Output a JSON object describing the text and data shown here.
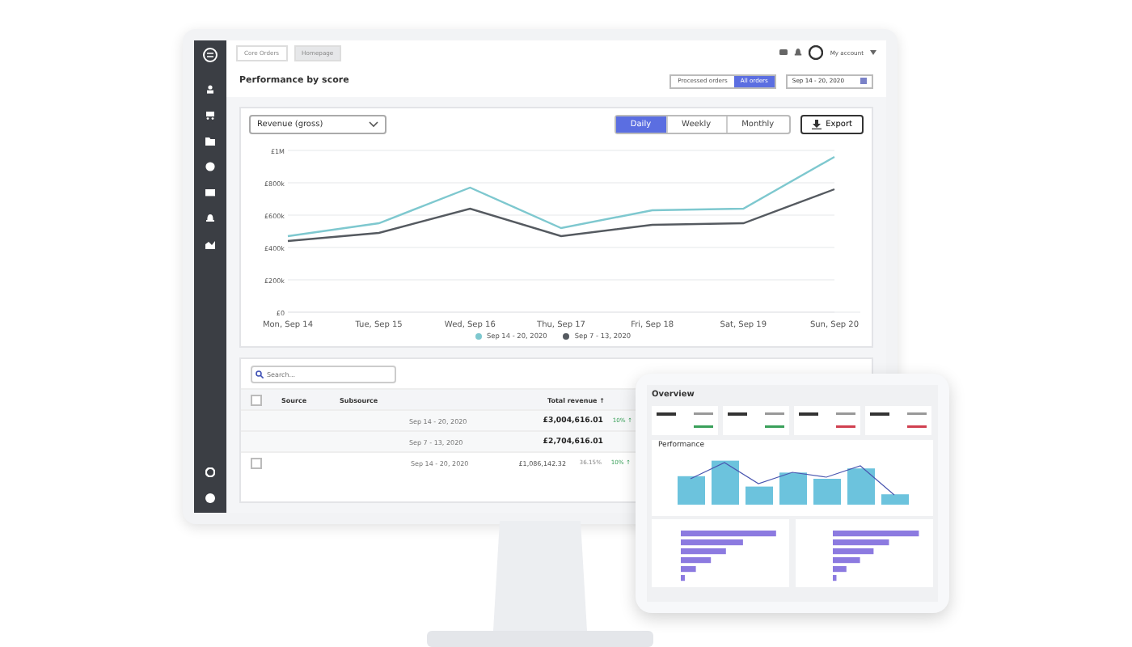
{
  "monitor": {
    "tabs": [
      {
        "label": "Core Orders",
        "selected": false
      },
      {
        "label": "Homepage",
        "selected": true
      }
    ],
    "account": "My account",
    "title": "Performance by score",
    "order_filter": [
      {
        "label": "Processed orders",
        "selected": false
      },
      {
        "label": "All orders",
        "selected": true
      }
    ],
    "date_range": "Sep 14 - 20, 2020",
    "metric_select": "Revenue (gross)",
    "periods": [
      {
        "label": "Daily",
        "selected": true
      },
      {
        "label": "Weekly",
        "selected": false
      },
      {
        "label": "Monthly",
        "selected": false
      }
    ],
    "export": "Export",
    "chart_data": {
      "type": "line",
      "categories": [
        "Mon, Sep 14",
        "Tue, Sep 15",
        "Wed, Sep 16",
        "Thu, Sep 17",
        "Fri, Sep 18",
        "Sat, Sep 19",
        "Sun, Sep 20"
      ],
      "series": [
        {
          "name": "Sep 14 - 20, 2020",
          "color": "#7ec8cf",
          "values": [
            470000,
            550000,
            770000,
            520000,
            630000,
            640000,
            960000
          ]
        },
        {
          "name": "Sep 7 - 13, 2020",
          "color": "#555a60",
          "values": [
            440000,
            490000,
            640000,
            470000,
            540000,
            550000,
            760000
          ]
        }
      ],
      "ylim": [
        0,
        1000000
      ],
      "grid": true,
      "yticks": [
        {
          "value": 0,
          "label": "£0"
        },
        {
          "value": 200000,
          "label": "£200k"
        },
        {
          "value": 400000,
          "label": "£400k"
        },
        {
          "value": 600000,
          "label": "£600k"
        },
        {
          "value": 800000,
          "label": "£800k"
        },
        {
          "value": 1000000,
          "label": "£1M"
        }
      ]
    },
    "search": {
      "placeholder": "Search..."
    },
    "table": {
      "header_checked": false,
      "columns": [
        "Source",
        "Subsource",
        "Total revenue ↑"
      ],
      "rows": [
        {
          "kind": "total",
          "period": "Sep 14 - 20, 2020",
          "revenue": "£3,004,616.01",
          "change": "10% ↑"
        },
        {
          "kind": "total",
          "period": "Sep 7 - 13, 2020",
          "revenue": "£2,704,616.01"
        },
        {
          "kind": "source",
          "checked": false,
          "period": "Sep 14 - 20, 2020",
          "revenue": "£1,086,142.32",
          "share": "36.15%",
          "change": "10% ↑"
        }
      ]
    }
  },
  "tablet": {
    "title": "Overview",
    "section": "Performance"
  }
}
